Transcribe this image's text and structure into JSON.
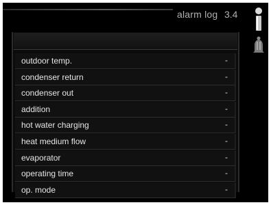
{
  "header": {
    "title": "alarm log",
    "page": "3.4"
  },
  "icons": {
    "status_top": "thermometer-status-icon",
    "status_bottom": "bell-icon"
  },
  "rows": [
    {
      "label": "outdoor temp.",
      "value": "-"
    },
    {
      "label": "condenser return",
      "value": "-"
    },
    {
      "label": "condenser out",
      "value": "-"
    },
    {
      "label": "addition",
      "value": "-"
    },
    {
      "label": "hot water charging",
      "value": "-"
    },
    {
      "label": "heat medium flow",
      "value": "-"
    },
    {
      "label": "evaporator",
      "value": "-"
    },
    {
      "label": "operating time",
      "value": "-"
    },
    {
      "label": "op. mode",
      "value": "-"
    }
  ]
}
